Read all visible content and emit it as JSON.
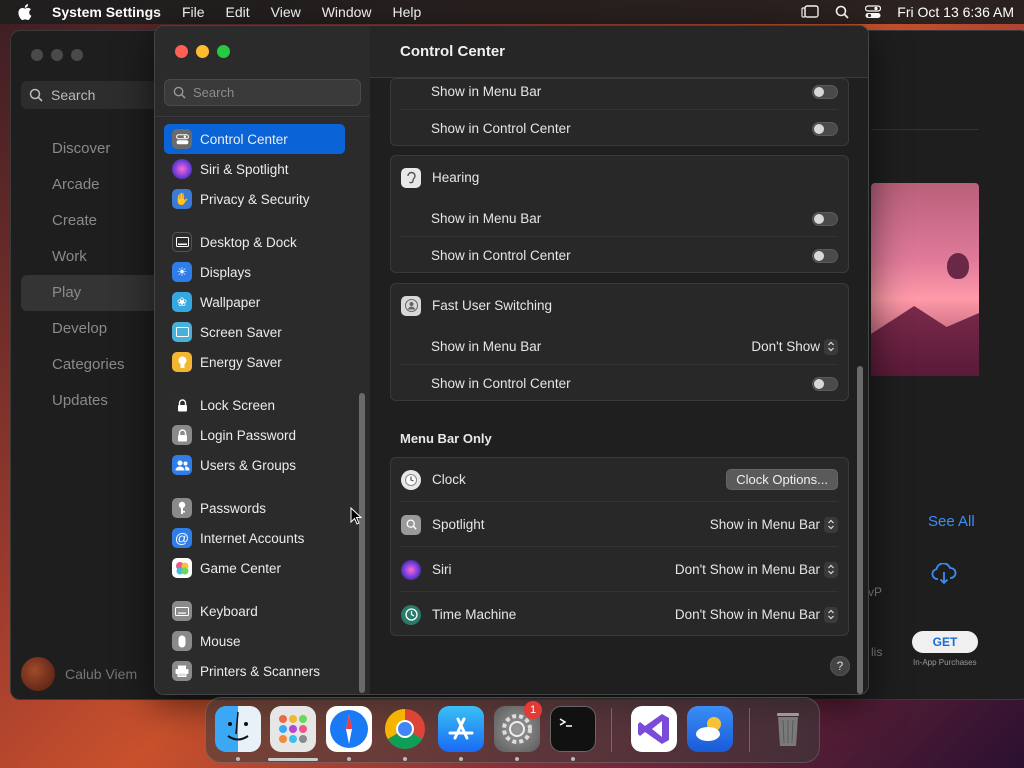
{
  "menubar": {
    "app": "System Settings",
    "items": [
      "File",
      "Edit",
      "View",
      "Window",
      "Help"
    ],
    "clock": "Fri Oct 13  6:36 AM"
  },
  "appstore": {
    "search_label": "Search",
    "nav": [
      "Discover",
      "Arcade",
      "Create",
      "Work",
      "Play",
      "Develop",
      "Categories",
      "Updates"
    ],
    "selected": "Play",
    "user": "Calub Viem",
    "see_all": "See All",
    "get": "GET",
    "in_app": "In-App Purchases",
    "vp_fragment": "vP",
    "lis_fragment": "lis"
  },
  "settings": {
    "search_placeholder": "Search",
    "sidebar": [
      {
        "label": "Control Center",
        "icon": "control-center-icon",
        "color": "#6b6b6b",
        "selected": true
      },
      {
        "label": "Siri & Spotlight",
        "icon": "siri-icon",
        "color": "#b347d6"
      },
      {
        "label": "Privacy & Security",
        "icon": "hand-icon",
        "color": "#3a7bd5"
      },
      {
        "label": "Desktop & Dock",
        "icon": "dock-icon",
        "color": "#2c2c2c"
      },
      {
        "label": "Displays",
        "icon": "sun-icon",
        "color": "#2f7ee8"
      },
      {
        "label": "Wallpaper",
        "icon": "flower-icon",
        "color": "#35a8e0"
      },
      {
        "label": "Screen Saver",
        "icon": "screensaver-icon",
        "color": "#4ab0d8"
      },
      {
        "label": "Energy Saver",
        "icon": "lightbulb-icon",
        "color": "#f2b632"
      },
      {
        "label": "Lock Screen",
        "icon": "lock-icon",
        "color": "#2c2c2c"
      },
      {
        "label": "Login Password",
        "icon": "lock-icon",
        "color": "#8a8a8a"
      },
      {
        "label": "Users & Groups",
        "icon": "users-icon",
        "color": "#2f7ee8"
      },
      {
        "label": "Passwords",
        "icon": "key-icon",
        "color": "#8a8a8a"
      },
      {
        "label": "Internet Accounts",
        "icon": "at-icon",
        "color": "#2f7ee8"
      },
      {
        "label": "Game Center",
        "icon": "game-center-icon",
        "color": "#e85a8a"
      },
      {
        "label": "Keyboard",
        "icon": "keyboard-icon",
        "color": "#8a8a8a"
      },
      {
        "label": "Mouse",
        "icon": "mouse-icon",
        "color": "#8a8a8a"
      },
      {
        "label": "Printers & Scanners",
        "icon": "printer-icon",
        "color": "#8a8a8a"
      }
    ],
    "title": "Control Center",
    "top_panel": {
      "rows": [
        {
          "label": "Show in Menu Bar",
          "control": "toggle",
          "on": false
        },
        {
          "label": "Show in Control Center",
          "control": "toggle",
          "on": false
        }
      ]
    },
    "hearing": {
      "title": "Hearing",
      "rows": [
        {
          "label": "Show in Menu Bar",
          "control": "toggle",
          "on": false
        },
        {
          "label": "Show in Control Center",
          "control": "toggle",
          "on": false
        }
      ]
    },
    "fast_user": {
      "title": "Fast User Switching",
      "rows": [
        {
          "label": "Show in Menu Bar",
          "control": "popup",
          "value": "Don't Show"
        },
        {
          "label": "Show in Control Center",
          "control": "toggle",
          "on": false
        }
      ]
    },
    "menu_bar_only": {
      "title": "Menu Bar Only",
      "rows": [
        {
          "label": "Clock",
          "control": "button",
          "value": "Clock Options...",
          "icon": "clock-icon"
        },
        {
          "label": "Spotlight",
          "control": "popup",
          "value": "Show in Menu Bar",
          "icon": "spotlight-icon"
        },
        {
          "label": "Siri",
          "control": "popup",
          "value": "Don't Show in Menu Bar",
          "icon": "siri-icon"
        },
        {
          "label": "Time Machine",
          "control": "popup",
          "value": "Don't Show in Menu Bar",
          "icon": "time-machine-icon"
        }
      ]
    },
    "help": "?"
  },
  "dock": {
    "apps": [
      "Finder",
      "Launchpad",
      "Safari",
      "Chrome",
      "App Store",
      "System Settings",
      "Terminal",
      "Visual Studio",
      "Weather",
      "Trash"
    ],
    "badge": "1"
  }
}
